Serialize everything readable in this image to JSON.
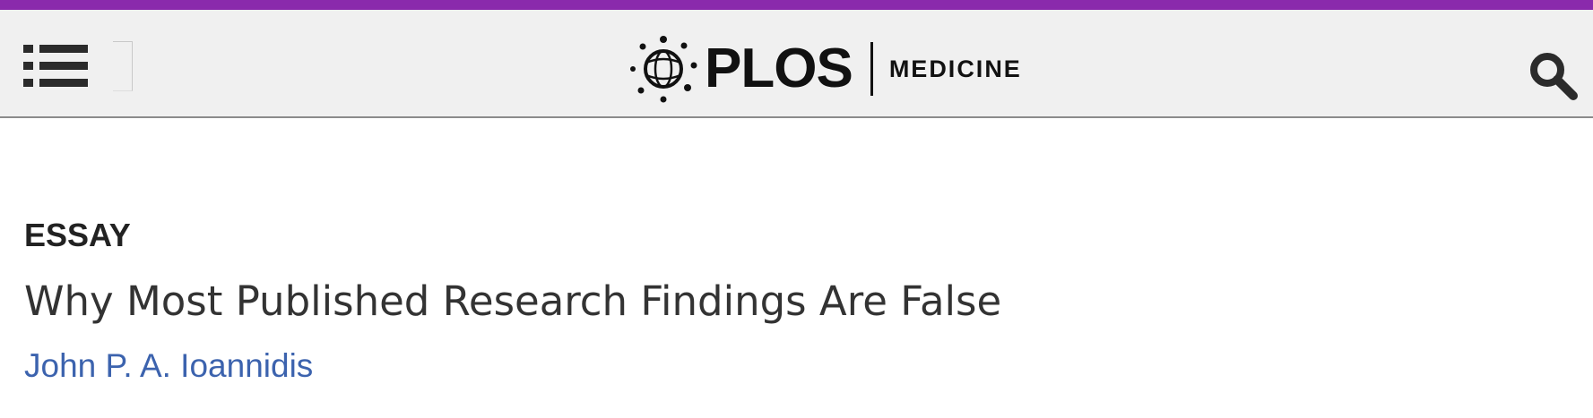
{
  "header": {
    "accent_color": "#8a2aac",
    "menu_icon": "list-menu-icon",
    "logo": {
      "wordmark": "PLOS",
      "journal": "MEDICINE",
      "icon": "plos-globe-icon"
    },
    "search_icon": "search-icon"
  },
  "article": {
    "type": "ESSAY",
    "title": "Why Most Published Research Findings Are False",
    "authors": [
      "John P. A. Ioannidis"
    ],
    "author_link_color": "#3c63ae"
  }
}
